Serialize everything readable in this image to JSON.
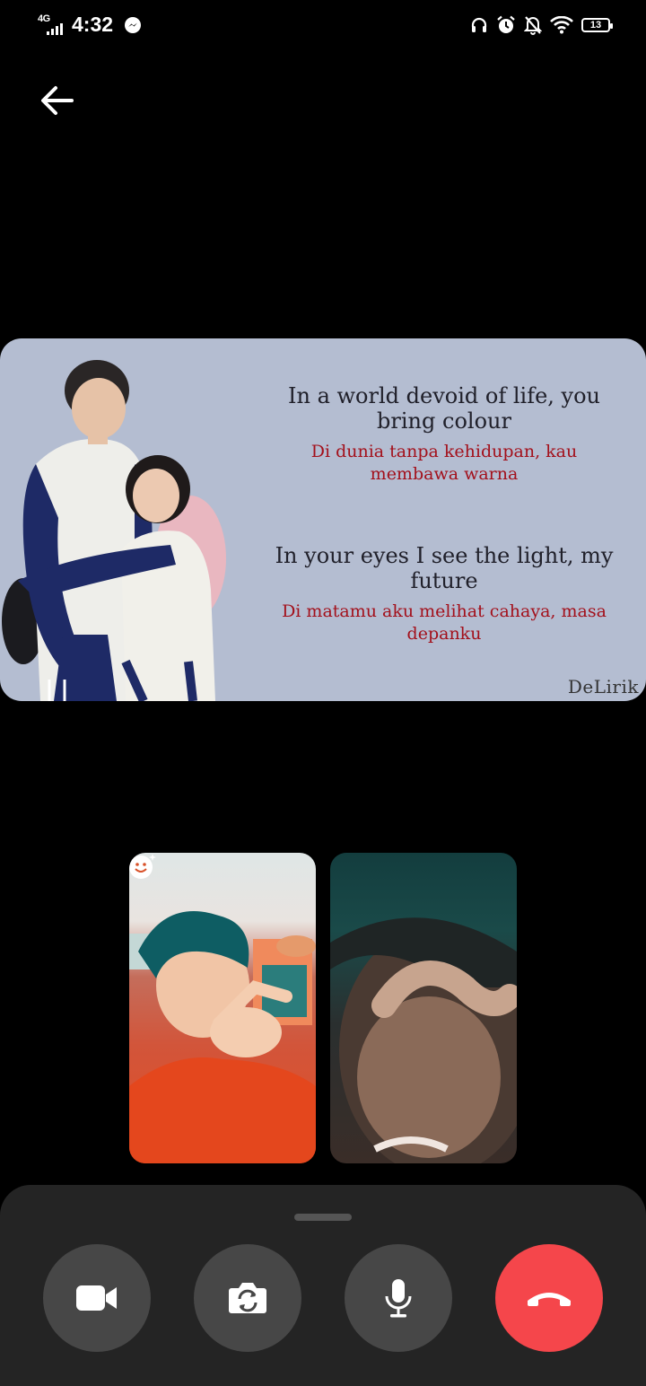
{
  "status_bar": {
    "network": "4G",
    "time": "4:32",
    "battery": "13"
  },
  "shared_screen": {
    "lyrics": [
      {
        "english": "In a world devoid of life, you bring colour",
        "indonesian": "Di dunia tanpa kehidupan, kau membawa warna"
      },
      {
        "english": "In your eyes I see the light, my future",
        "indonesian": "Di matamu aku melihat cahaya, masa depanku"
      }
    ],
    "watermark": "DeLirik"
  },
  "controls": {
    "end_call_color": "#f5464b"
  },
  "icons": [
    "back-arrow-icon",
    "messenger-icon",
    "headphones-icon",
    "alarm-icon",
    "notifications-off-icon",
    "wifi-icon",
    "battery-icon",
    "effects-icon",
    "video-camera-icon",
    "flip-camera-icon",
    "microphone-icon",
    "end-call-icon"
  ]
}
